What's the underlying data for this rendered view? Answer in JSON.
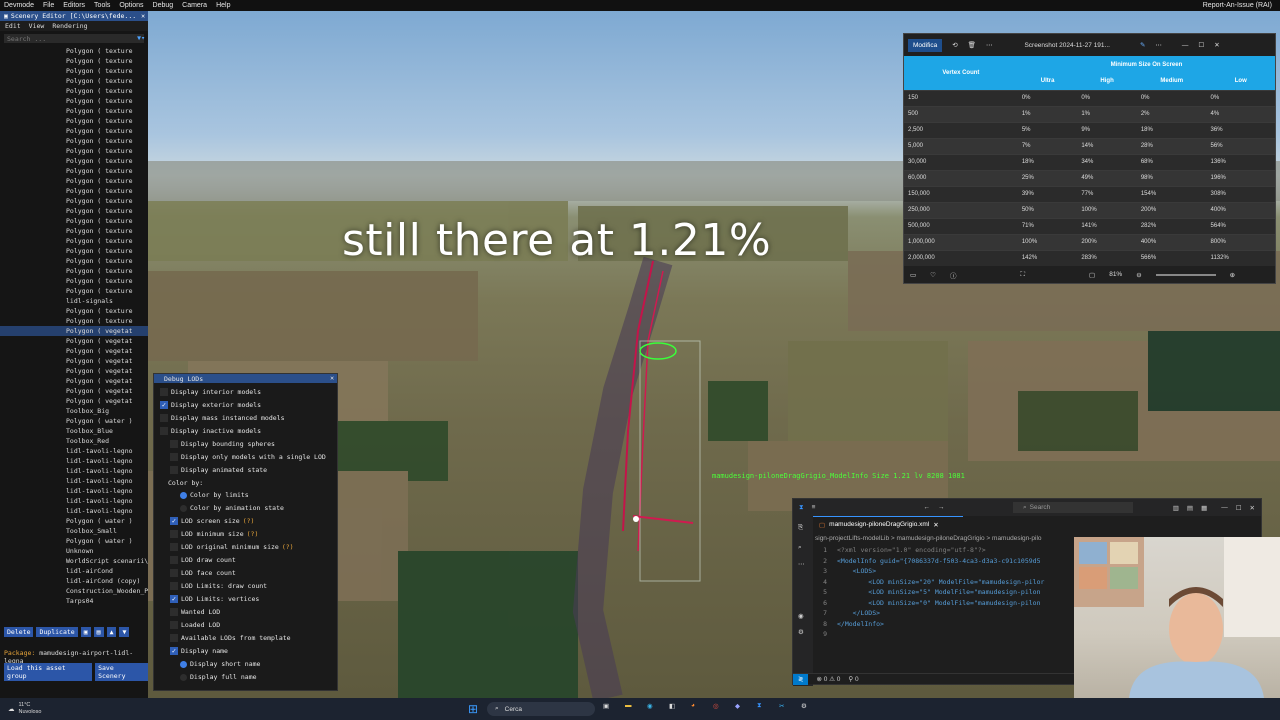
{
  "devbar": {
    "items": [
      "Devmode",
      "File",
      "Editors",
      "Tools",
      "Options",
      "Debug",
      "Camera",
      "Help"
    ],
    "right": "Report-An-Issue (RAI)"
  },
  "overlay": {
    "caption": "still there at 1.21%",
    "green_label": "mamudesign-piloneDragGrigio_ModelInfo  Size 1.21  lv 8208 1081"
  },
  "left_panel": {
    "title": "Scenery Editor [C:\\Users\\fede...",
    "menu": [
      "Edit",
      "View",
      "Rendering"
    ],
    "search_placeholder": "Search ...",
    "items": [
      "Polygon  ( texture",
      "Polygon  ( texture",
      "Polygon  ( texture",
      "Polygon  ( texture",
      "Polygon  ( texture",
      "Polygon  ( texture",
      "Polygon  ( texture",
      "Polygon  ( texture",
      "Polygon  ( texture",
      "Polygon  ( texture",
      "Polygon  ( texture",
      "Polygon  ( texture",
      "Polygon  ( texture",
      "Polygon  ( texture",
      "Polygon  ( texture",
      "Polygon  ( texture",
      "Polygon  ( texture",
      "Polygon  ( texture",
      "Polygon  ( texture",
      "Polygon  ( texture",
      "Polygon  ( texture",
      "Polygon  ( texture",
      "Polygon  ( texture",
      "Polygon  ( texture",
      "Polygon  ( texture",
      "lidl-signals",
      "Polygon  ( texture",
      "Polygon  ( texture",
      "Polygon  ( vegetat",
      "Polygon  ( vegetat",
      "Polygon  ( vegetat",
      "Polygon  ( vegetat",
      "Polygon  ( vegetat",
      "Polygon  ( vegetat",
      "Polygon  ( vegetat",
      "Polygon  ( vegetat",
      "Toolbox_Big",
      "Polygon  ( water )",
      "Toolbox_Blue",
      "Toolbox_Red",
      "lidl-tavoli-legno",
      "lidl-tavoli-legno",
      "lidl-tavoli-legno",
      "lidl-tavoli-legno",
      "lidl-tavoli-legno",
      "lidl-tavoli-legno",
      "lidl-tavoli-legno",
      "Polygon  ( water )",
      "Toolbox_Small",
      "Polygon  ( water )",
      "Unknown",
      "WorldScript scenarii\\",
      "lidl-airCond",
      "lidl-airCond (copy)",
      "Construction_Wooden_P",
      "Tarps04"
    ],
    "selected_index": 28,
    "buttons": [
      "Delete",
      "Duplicate"
    ],
    "package_label": "Package:",
    "package_value": "mamudesign-airport-lidl-legna",
    "buttons2": [
      "Load this asset group",
      "Save Scenery"
    ]
  },
  "debug_lods": {
    "title": "Debug LODs",
    "options": [
      {
        "label": "Display interior models",
        "checked": false
      },
      {
        "label": "Display exterior models",
        "checked": true
      },
      {
        "label": "Display mass instanced models",
        "checked": false
      },
      {
        "label": "Display inactive models",
        "checked": false
      },
      {
        "label": "Display bounding spheres",
        "checked": false
      },
      {
        "label": "Display only models with a single LOD",
        "checked": false
      },
      {
        "label": "Display animated state",
        "checked": false
      }
    ],
    "color_by_label": "Color by:",
    "color_by": [
      {
        "label": "Color by limits",
        "selected": true
      },
      {
        "label": "Color by animation state",
        "selected": false
      }
    ],
    "options2": [
      {
        "label": "LOD screen size",
        "checked": true,
        "help": "(?)"
      },
      {
        "label": "LOD minimum size",
        "checked": false,
        "help": "(?)"
      },
      {
        "label": "LOD original minimum size",
        "checked": false,
        "help": "(?)"
      },
      {
        "label": "LOD draw count",
        "checked": false,
        "help": ""
      },
      {
        "label": "LOD face count",
        "checked": false,
        "help": ""
      },
      {
        "label": "LOD Limits: draw count",
        "checked": false,
        "help": ""
      },
      {
        "label": "LOD Limits: vertices",
        "checked": true,
        "help": ""
      },
      {
        "label": "Wanted LOD",
        "checked": false,
        "help": ""
      },
      {
        "label": "Loaded LOD",
        "checked": false,
        "help": ""
      },
      {
        "label": "Available LODs from template",
        "checked": false,
        "help": ""
      },
      {
        "label": "Display name",
        "checked": true,
        "help": ""
      }
    ],
    "name_opts": [
      {
        "label": "Display short name",
        "selected": true
      },
      {
        "label": "Display full name",
        "selected": false
      }
    ]
  },
  "screenshot_window": {
    "modifica": "Modifica",
    "filename": "Screenshot 2024-11-27 191...",
    "headers": {
      "vertex": "Vertex Count",
      "group": "Minimum Size On Screen",
      "cols": [
        "Ultra",
        "High",
        "Medium",
        "Low"
      ]
    },
    "rows": [
      [
        "150",
        "0%",
        "0%",
        "0%",
        "0%"
      ],
      [
        "500",
        "1%",
        "1%",
        "2%",
        "4%"
      ],
      [
        "2,500",
        "5%",
        "9%",
        "18%",
        "36%"
      ],
      [
        "5,000",
        "7%",
        "14%",
        "28%",
        "56%"
      ],
      [
        "30,000",
        "18%",
        "34%",
        "68%",
        "136%"
      ],
      [
        "60,000",
        "25%",
        "49%",
        "98%",
        "196%"
      ],
      [
        "150,000",
        "39%",
        "77%",
        "154%",
        "308%"
      ],
      [
        "250,000",
        "50%",
        "100%",
        "200%",
        "400%"
      ],
      [
        "500,000",
        "71%",
        "141%",
        "282%",
        "564%"
      ],
      [
        "1,000,000",
        "100%",
        "200%",
        "400%",
        "800%"
      ],
      [
        "2,000,000",
        "142%",
        "283%",
        "566%",
        "1132%"
      ]
    ],
    "zoom": "81%"
  },
  "vscode": {
    "search_placeholder": "Search",
    "tab": "mamudesign-piloneDragGrigio.xml",
    "breadcrumb": "sign-projectLifts-modelLib > mamudesign-piloneDragGrigio > mamudesign-pilo",
    "lines": [
      {
        "n": "1",
        "code": "<?xml version=\"1.0\" encoding=\"utf-8\"?>"
      },
      {
        "n": "2",
        "code": "<ModelInfo guid=\"{7086337d-f503-4ca3-d3a3-c91c1059d5"
      },
      {
        "n": "3",
        "code": "    <LODS>"
      },
      {
        "n": "4",
        "code": "        <LOD minSize=\"20\" ModelFile=\"mamudesign-pilor"
      },
      {
        "n": "5",
        "code": "        <LOD minSize=\"5\" ModelFile=\"mamudesign-pilon"
      },
      {
        "n": "6",
        "code": "        <LOD minSize=\"0\" ModelFile=\"mamudesign-pilon"
      },
      {
        "n": "7",
        "code": "    </LODS>"
      },
      {
        "n": "8",
        "code": "</ModelInfo>"
      },
      {
        "n": "9",
        "code": ""
      }
    ],
    "status": [
      "⊗ 0 ⚠ 0",
      "⚲ 0"
    ]
  },
  "taskbar": {
    "weather_temp": "11°C",
    "weather_desc": "Nuvoloso",
    "search": "Cerca"
  }
}
